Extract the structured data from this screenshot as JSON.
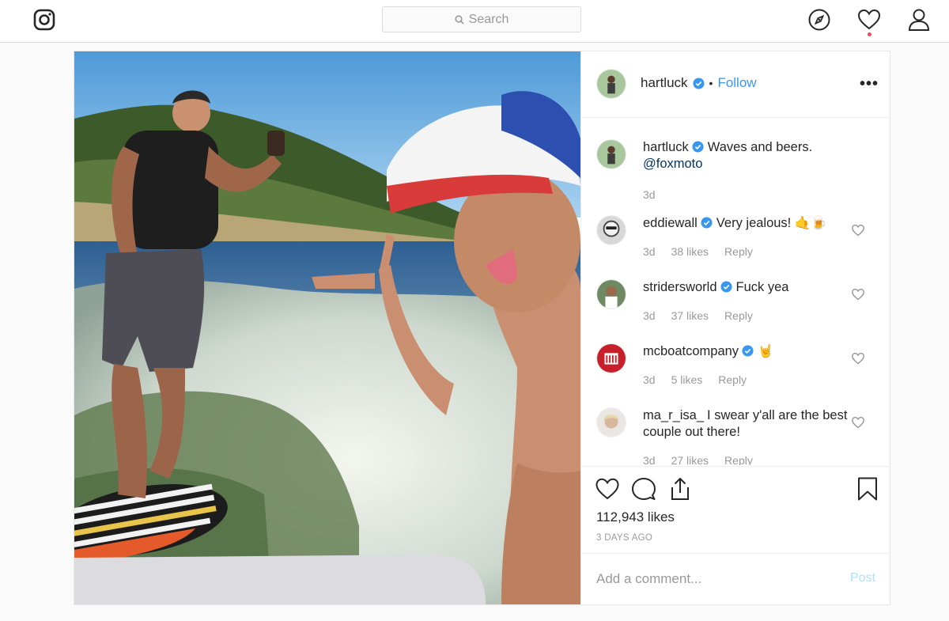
{
  "nav": {
    "search_placeholder": "Search",
    "icons": [
      "instagram-logo",
      "search-icon",
      "compass-icon",
      "heart-icon",
      "user-icon"
    ]
  },
  "post": {
    "author": "hartluck",
    "follow_label": "Follow",
    "separator": "•",
    "more_label": "•••",
    "caption": {
      "username": "hartluck",
      "text": "Waves and beers.",
      "mention": "@foxmoto",
      "time": "3d"
    },
    "comments": [
      {
        "username": "eddiewall",
        "verified": true,
        "text": "Very jealous! 🤙🍺",
        "time": "3d",
        "likes": "38 likes",
        "reply": "Reply"
      },
      {
        "username": "stridersworld",
        "verified": true,
        "text": "Fuck yea",
        "time": "3d",
        "likes": "37 likes",
        "reply": "Reply"
      },
      {
        "username": "mcboatcompany",
        "verified": true,
        "text": "🤘",
        "time": "3d",
        "likes": "5 likes",
        "reply": "Reply"
      },
      {
        "username": "ma_r_isa_",
        "verified": false,
        "text": "I swear y'all are the best couple out there!",
        "time": "3d",
        "likes": "27 likes",
        "reply": "Reply"
      }
    ],
    "likes": "112,943 likes",
    "time_ago": "3 DAYS AGO",
    "add_comment_placeholder": "Add a comment...",
    "post_label": "Post",
    "colors": {
      "link": "#3897f0",
      "verified": "#3897f0",
      "post_disabled": "#b2dffc"
    }
  }
}
